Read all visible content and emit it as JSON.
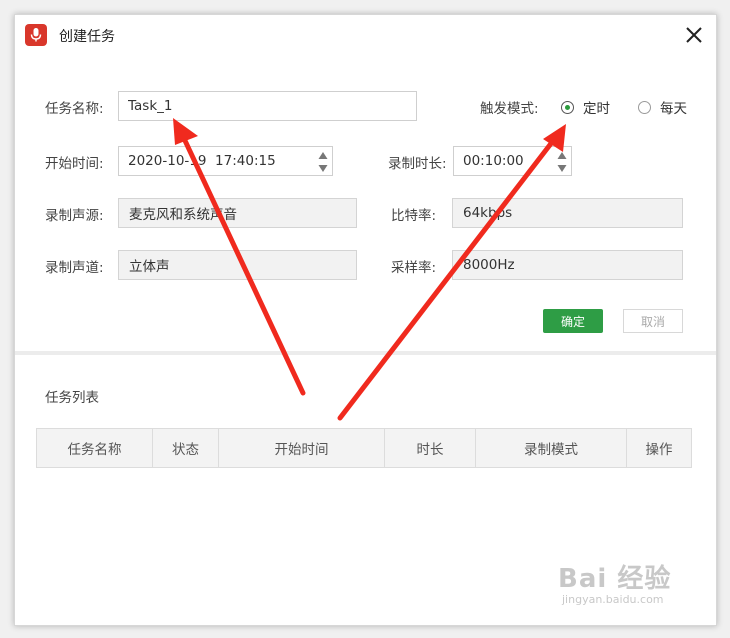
{
  "window": {
    "title": "创建任务"
  },
  "form": {
    "task_name_label": "任务名称:",
    "task_name_value": "Task_1",
    "trigger_mode_label": "触发模式:",
    "trigger_options": [
      {
        "label": "定时",
        "checked": true
      },
      {
        "label": "每天",
        "checked": false
      }
    ],
    "start_time_label": "开始时间:",
    "start_time_value": "2020-10-19  17:40:15",
    "duration_label": "录制时长:",
    "duration_value": "00:10:00",
    "source_label": "录制声源:",
    "source_value": "麦克风和系统声音",
    "bitrate_label": "比特率:",
    "bitrate_value": "64kbps",
    "channel_label": "录制声道:",
    "channel_value": "立体声",
    "samplerate_label": "采样率:",
    "samplerate_value": "8000Hz",
    "ok_label": "确定",
    "cancel_label": "取消"
  },
  "task_list": {
    "title": "任务列表",
    "columns": [
      "任务名称",
      "状态",
      "开始时间",
      "时长",
      "录制模式",
      "操作"
    ]
  },
  "watermark": {
    "main": "Bai 经验",
    "sub": "jingyan.baidu.com"
  },
  "colors": {
    "app_icon": "#d9372b",
    "primary_button": "#2e9d45",
    "annotation_arrow": "#f02a1e"
  }
}
